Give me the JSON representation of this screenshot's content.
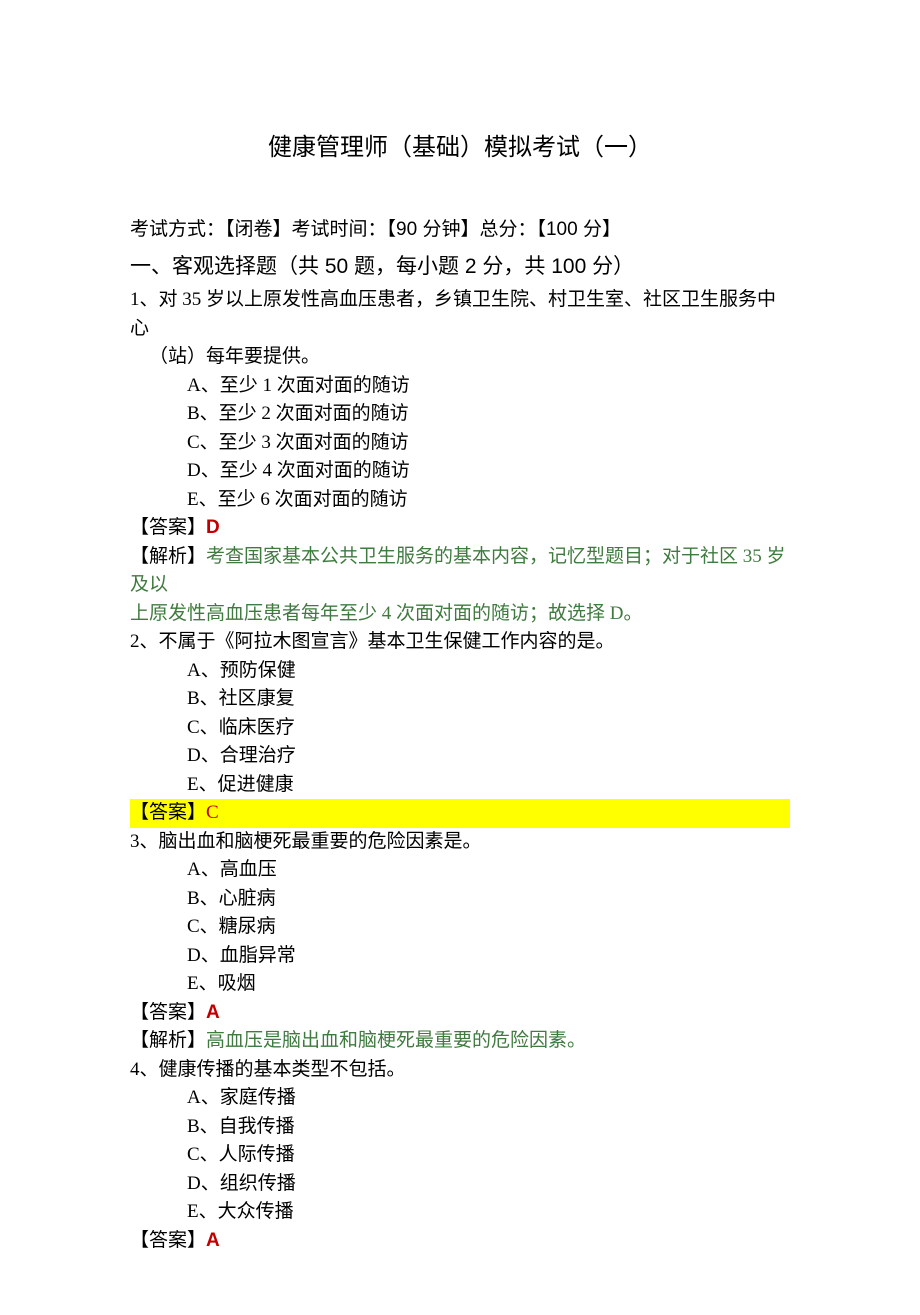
{
  "title": "健康管理师（基础）模拟考试（一）",
  "meta": {
    "label_mode": "考试方式：",
    "mode": "【闭卷】",
    "label_time": "考试时间：",
    "time": "【90 分钟】",
    "label_total": "总分：",
    "total": "【100 分】"
  },
  "section": {
    "prefix": "一、客观选择题",
    "detail": "（共 50 题，每小题 2 分，共 100 分）"
  },
  "q1": {
    "no": "1、",
    "stem_l1": "对 35 岁以上原发性高血压患者，乡镇卫生院、村卫生室、社区卫生服务中心",
    "stem_l2": "（站）每年要提供。",
    "opts": {
      "a": "A、至少 1 次面对面的随访",
      "b": "B、至少 2 次面对面的随访",
      "c": "C、至少 3 次面对面的随访",
      "d": "D、至少 4 次面对面的随访",
      "e": "E、至少 6 次面对面的随访"
    },
    "answer_label": "【答案】",
    "answer": "D",
    "analysis_label": "【解析】",
    "analysis_l1": "考查国家基本公共卫生服务的基本内容，记忆型题目；对于社区 35 岁及以",
    "analysis_l2": "上原发性高血压患者每年至少 4 次面对面的随访；故选择 D。"
  },
  "q2": {
    "no": "2、",
    "stem": "不属于《阿拉木图宣言》基本卫生保健工作内容的是。",
    "opts": {
      "a": "A、预防保健",
      "b": "B、社区康复",
      "c": "C、临床医疗",
      "d": "D、合理治疗",
      "e": "E、促进健康"
    },
    "answer_label": "【答案】",
    "answer": "C"
  },
  "q3": {
    "no": "3、",
    "stem": "脑出血和脑梗死最重要的危险因素是。",
    "opts": {
      "a": "A、高血压",
      "b": "B、心脏病",
      "c": "C、糖尿病",
      "d": "D、血脂异常",
      "e": "E、吸烟"
    },
    "answer_label": "【答案】",
    "answer": "A",
    "analysis_label": "【解析】",
    "analysis": "高血压是脑出血和脑梗死最重要的危险因素。"
  },
  "q4": {
    "no": "4、",
    "stem": "健康传播的基本类型不包括。",
    "opts": {
      "a": "A、家庭传播",
      "b": "B、自我传播",
      "c": "C、人际传播",
      "d": "D、组织传播",
      "e": "E、大众传播"
    },
    "answer_label": "【答案】",
    "answer": "A"
  }
}
